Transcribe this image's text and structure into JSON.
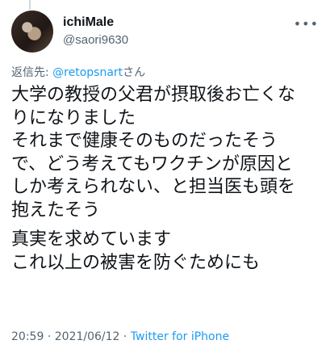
{
  "author": {
    "display_name": "ichiMale",
    "handle": "@saori9630"
  },
  "reply_to": {
    "prefix": "返信先:",
    "mention": "@retopsnart",
    "suffix": "さん"
  },
  "tweet": {
    "paragraphs": [
      [
        "大学の教授の父君が摂取後お亡くな",
        "りになりました",
        "それまで健康そのものだったそう",
        "で、どう考えてもワクチンが原因と",
        "しか考えられない、と担当医も頭を",
        "抱えたそう"
      ],
      [
        "真実を求めています",
        "これ以上の被害を防ぐためにも"
      ]
    ]
  },
  "meta": {
    "time": "20:59",
    "date": "2021/06/12",
    "separator": "·",
    "source": "Twitter for iPhone"
  },
  "more_icon": "more-horizontal-icon",
  "colors": {
    "text": "#0f1419",
    "secondary": "#536471",
    "link": "#1d9bf0"
  }
}
